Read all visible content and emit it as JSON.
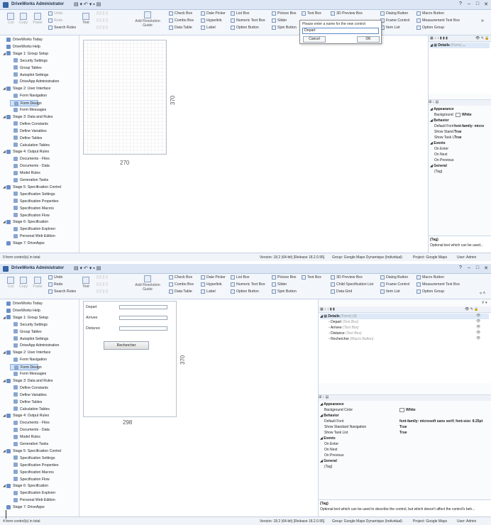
{
  "app": {
    "title": "DriveWorks Administrator",
    "help": "?",
    "min": "–",
    "max": "□",
    "close": "✕"
  },
  "ribbon": {
    "cut": "Cut",
    "copy": "Copy",
    "paste": "Paste",
    "undo": "Undo",
    "redo": "Redo",
    "search_rules": "Search Rules",
    "text": "Text",
    "add_resolution_guide": "Add Resolution Guide",
    "check_box": "Check Box",
    "date_picker": "Date Picker",
    "list_box": "List Box",
    "picture_box": "Picture Box",
    "text_box": "Text Box",
    "preview_box_3d": "3D Preview Box",
    "dialog_button": "Dialog Button",
    "macro_button": "Macro Button",
    "combo_box": "Combo Box",
    "hyperlink": "Hyperlink",
    "numeric_text_box": "Numeric Text Box",
    "slider": "Slider",
    "child_spec_list": "Child Specification List",
    "frame_control": "Frame Control",
    "measurement_text_box": "Measurement Text Box",
    "data_table": "Data Table",
    "label": "Label",
    "option_button": "Option Button",
    "spin_button": "Spin Button",
    "data_grid": "Data Grid",
    "item_list": "Item List",
    "option_group": "Option Group"
  },
  "popup": {
    "message": "Please enter a name for the new control:",
    "value": "Depart",
    "cancel": "Cancel",
    "ok": "OK"
  },
  "nav": [
    {
      "label": "DriveWorks Today",
      "level": 0
    },
    {
      "label": "DriveWorks Help",
      "level": 0
    },
    {
      "label": "Stage 1: Group Setup",
      "level": 0,
      "tw": "◢"
    },
    {
      "label": "Security Settings",
      "level": 1
    },
    {
      "label": "Group Tables",
      "level": 1
    },
    {
      "label": "Autopilot Settings",
      "level": 1
    },
    {
      "label": "DriveApp Administration",
      "level": 1
    },
    {
      "label": "Stage 2: User Interface",
      "level": 0,
      "tw": "◢"
    },
    {
      "label": "Form Navigation",
      "level": 1
    },
    {
      "label": "Form Design",
      "level": 1,
      "selected": true
    },
    {
      "label": "Form Messages",
      "level": 1
    },
    {
      "label": "Stage 3: Data and Rules",
      "level": 0,
      "tw": "◢"
    },
    {
      "label": "Define Constants",
      "level": 1
    },
    {
      "label": "Define Variables",
      "level": 1
    },
    {
      "label": "Define Tables",
      "level": 1
    },
    {
      "label": "Calculation Tables",
      "level": 1
    },
    {
      "label": "Stage 4: Output Rules",
      "level": 0,
      "tw": "◢"
    },
    {
      "label": "Documents - Files",
      "level": 1
    },
    {
      "label": "Documents - Data",
      "level": 1
    },
    {
      "label": "Model Rules",
      "level": 1
    },
    {
      "label": "Generation Tasks",
      "level": 1
    },
    {
      "label": "Stage 5: Specification Control",
      "level": 0,
      "tw": "◢"
    },
    {
      "label": "Specification Settings",
      "level": 1
    },
    {
      "label": "Specification Properties",
      "level": 1
    },
    {
      "label": "Specification Macros",
      "level": 1
    },
    {
      "label": "Specification Flow",
      "level": 1
    },
    {
      "label": "Stage 6: Specification",
      "level": 0,
      "tw": "◢"
    },
    {
      "label": "Specification Explorer",
      "level": 1
    },
    {
      "label": "Personal Web Edition",
      "level": 1
    },
    {
      "label": "Stage 7: DriveApps",
      "level": 0
    }
  ],
  "shot1": {
    "width_label": "270",
    "height_label": "370",
    "tree_title": "Details",
    "tree_title_type": "(Form) ₍₆₎",
    "props": {
      "appearance": "Appearance",
      "background": "Background",
      "background_val": "White",
      "behavior": "Behavior",
      "default_font": "Default Font",
      "default_font_val": "font-family: micro",
      "show_stand": "Show Stand.",
      "show_stand_val": "True",
      "show_task": "Show Task L",
      "show_task_val": "True",
      "events": "Events",
      "on_enter": "On Enter",
      "on_next": "On Next",
      "on_previous": "On Previous",
      "general": "General",
      "tag": "(Tag)"
    },
    "desc_title": "(Tag)",
    "desc_text": "Optional text which can be used...",
    "status_left": "0 form control(s) in total",
    "status_version": "Version: 18.2 (64-bit) [Release 18.2.0.95]",
    "status_group": "Group: Google Maps Dynamique (Individual)",
    "status_project": "Project: Google Maps",
    "status_user": "User: Admin"
  },
  "shot2": {
    "width_label": "298",
    "height_label": "370",
    "form": {
      "depart": "Depart",
      "arrivee": "Arrivee",
      "distance": "Distance",
      "button": "Rechercher"
    },
    "tree_title": "Details",
    "tree_title_type": "(Form) (4)",
    "tree_items": [
      {
        "name": "Depart",
        "type": "(Text Box)"
      },
      {
        "name": "Arrivee",
        "type": "(Text Box)"
      },
      {
        "name": "Distance",
        "type": "(Text Box)"
      },
      {
        "name": "Rechercher",
        "type": "(Macro Button)"
      }
    ],
    "props": {
      "appearance": "Appearance",
      "background": "Background Color",
      "background_val": "White",
      "behavior": "Behavior",
      "default_font": "Default Font",
      "default_font_val": "font-family: microsoft sans serif; font-size: 8.25pt",
      "show_stand": "Show Standard Navigation",
      "show_stand_val": "True",
      "show_task": "Show Task List",
      "show_task_val": "True",
      "events": "Events",
      "on_enter": "On Enter",
      "on_next": "On Next",
      "on_previous": "On Previous",
      "general": "General",
      "tag": "(Tag)"
    },
    "desc_title": "(Tag)",
    "desc_text": "Optional text which can be used to describe the control, but which doesn't affect the control's beh...",
    "status_left": "4 form control(s) in total",
    "status_version": "Version: 18.2 (64-bit) [Release 18.2.0.95]",
    "status_group": "Group: Google Maps Dynamique (Individual)",
    "status_project": "Project: Google Maps",
    "status_user": "User: Admin"
  }
}
